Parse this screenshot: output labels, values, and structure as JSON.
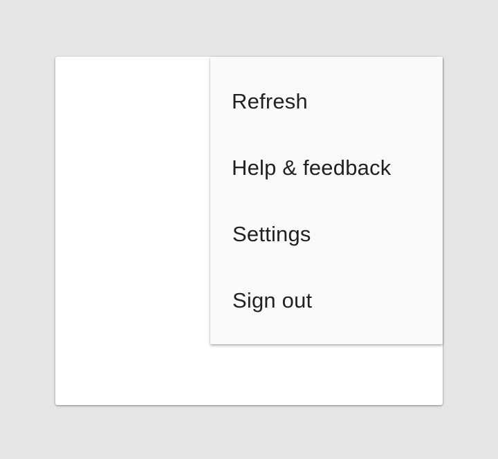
{
  "menu": {
    "items": [
      {
        "label": "Refresh"
      },
      {
        "label": "Help & feedback"
      },
      {
        "label": "Settings"
      },
      {
        "label": "Sign out"
      }
    ]
  },
  "colors": {
    "page_background": "#e5e5e5",
    "card_background": "#ffffff",
    "menu_background": "#fafafa",
    "menu_text": "#212121"
  }
}
